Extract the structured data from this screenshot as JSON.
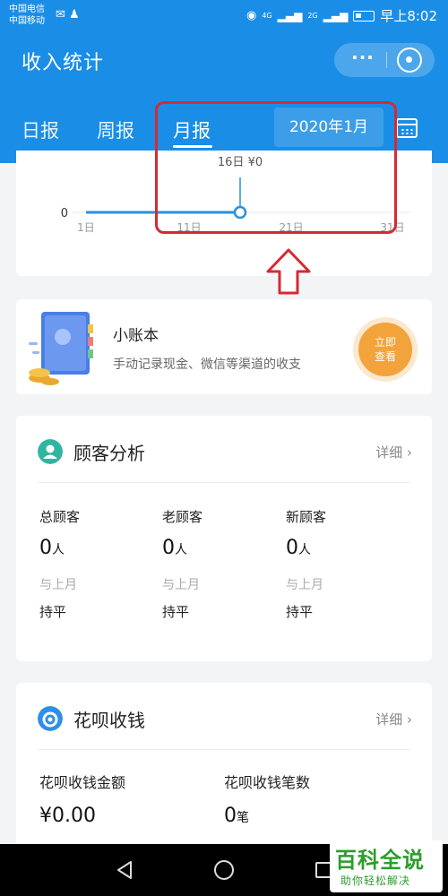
{
  "status_bar": {
    "carrier_1": "中国电信",
    "carrier_2": "中国移动",
    "time": "早上8:02",
    "network_1": "4G",
    "network_2": "2G"
  },
  "header": {
    "title": "收入统计",
    "more_label": "···",
    "tabs": [
      {
        "label": "日报",
        "active": false
      },
      {
        "label": "周报",
        "active": false
      },
      {
        "label": "月报",
        "active": true
      }
    ],
    "date": "2020年1月"
  },
  "chart": {
    "y_label": "0",
    "tooltip": "16日 ¥0",
    "x_ticks": [
      "1日",
      "11日",
      "21日",
      "31日"
    ],
    "line_color": "#2b8fdc"
  },
  "ledger": {
    "title": "小账本",
    "subtitle": "手动记录现金、微信等渠道的收支",
    "button_line1": "立即",
    "button_line2": "查看"
  },
  "customer": {
    "title": "顾客分析",
    "more": "详细 ›",
    "stats": [
      {
        "label": "总顾客",
        "value": "0",
        "unit": "人",
        "compare": "与上月",
        "compare_value": "持平"
      },
      {
        "label": "老顾客",
        "value": "0",
        "unit": "人",
        "compare": "与上月",
        "compare_value": "持平"
      },
      {
        "label": "新顾客",
        "value": "0",
        "unit": "人",
        "compare": "与上月",
        "compare_value": "持平"
      }
    ]
  },
  "huabei": {
    "title": "花呗收钱",
    "more": "详细 ›",
    "amount_label": "花呗收钱金额",
    "amount_value": "¥0.00",
    "count_label": "花呗收钱笔数",
    "count_value": "0",
    "count_unit": "笔"
  },
  "watermark": {
    "title": "百科全说",
    "subtitle": "助你轻松解决"
  },
  "colors": {
    "brand_blue": "#1a8ee6",
    "annotation_red": "#d42a33",
    "button_orange": "#f3a33b",
    "watermark_green": "#2d9c2d"
  }
}
